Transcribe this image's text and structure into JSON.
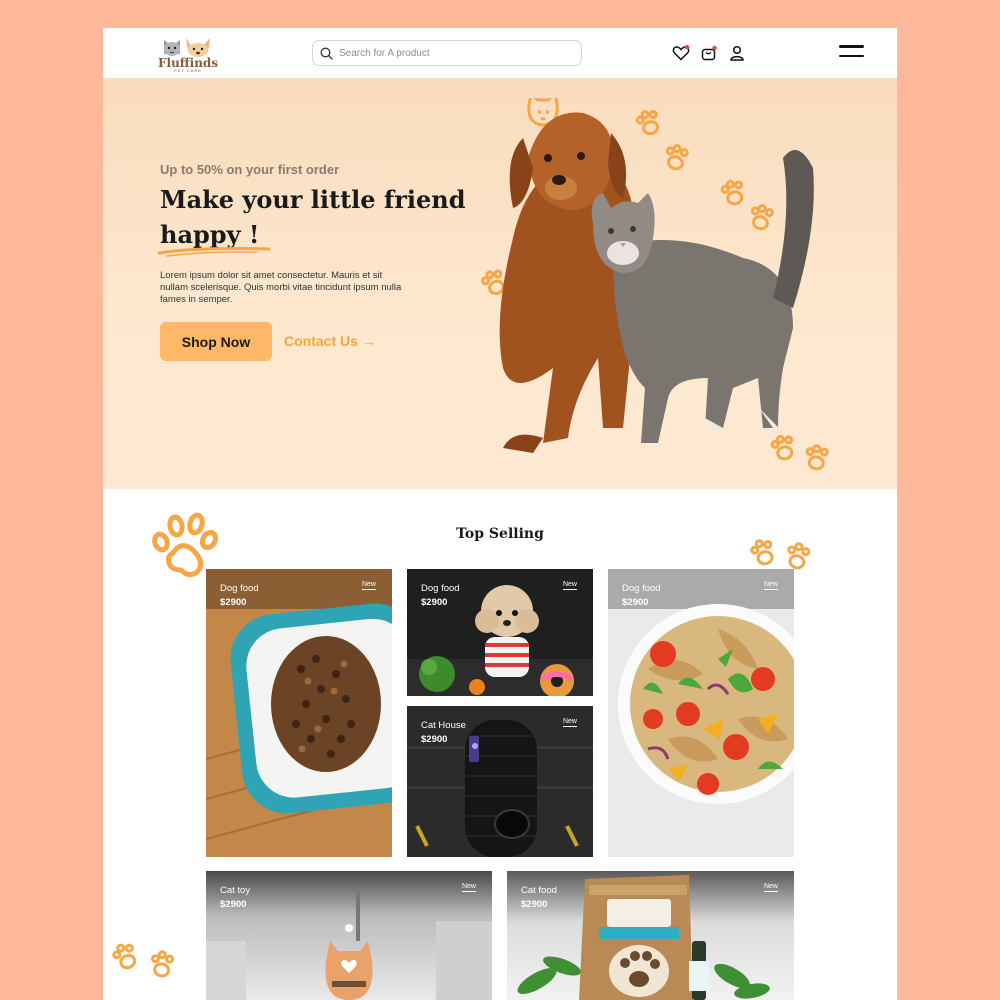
{
  "brand": {
    "name": "Fluffinds",
    "tagline": "PET CARE",
    "colors": {
      "accent": "#ffb867",
      "link": "#f3a43c",
      "paw": "#f7a645",
      "page_bg": "#fdb99a"
    }
  },
  "header": {
    "search_placeholder": "Search for A product",
    "icons": [
      "heart-icon",
      "cart-icon",
      "user-icon",
      "menu-icon"
    ]
  },
  "hero": {
    "promo": "Up to 50% on your first order",
    "headline_line1": "Make your little friend",
    "headline_line2": "happy !",
    "description": "Lorem ipsum dolor sit amet consectetur. Mauris et sit nullam scelerisque. Quis morbi vitae tincidunt ipsum nulla fames in semper.",
    "shop_button": "Shop Now",
    "contact_link": "Contact Us →"
  },
  "top_selling": {
    "title": "Top Selling",
    "products": [
      {
        "category": "Dog food",
        "price": "$2900",
        "badge": "New",
        "image": "kibble-bowl"
      },
      {
        "category": "Dog food",
        "price": "$2900",
        "badge": "New",
        "image": "poodle-with-toys"
      },
      {
        "category": "Cat House",
        "price": "$2900",
        "badge": "New",
        "image": "cat-tower"
      },
      {
        "category": "Dog food",
        "price": "$2900",
        "badge": "New",
        "image": "pasta-salad-bowl"
      },
      {
        "category": "Cat toy",
        "price": "$2900",
        "badge": "New",
        "image": "cat-figurine-toy"
      },
      {
        "category": "Cat food",
        "price": "$2900",
        "badge": "New",
        "image": "treat-bag"
      }
    ]
  }
}
